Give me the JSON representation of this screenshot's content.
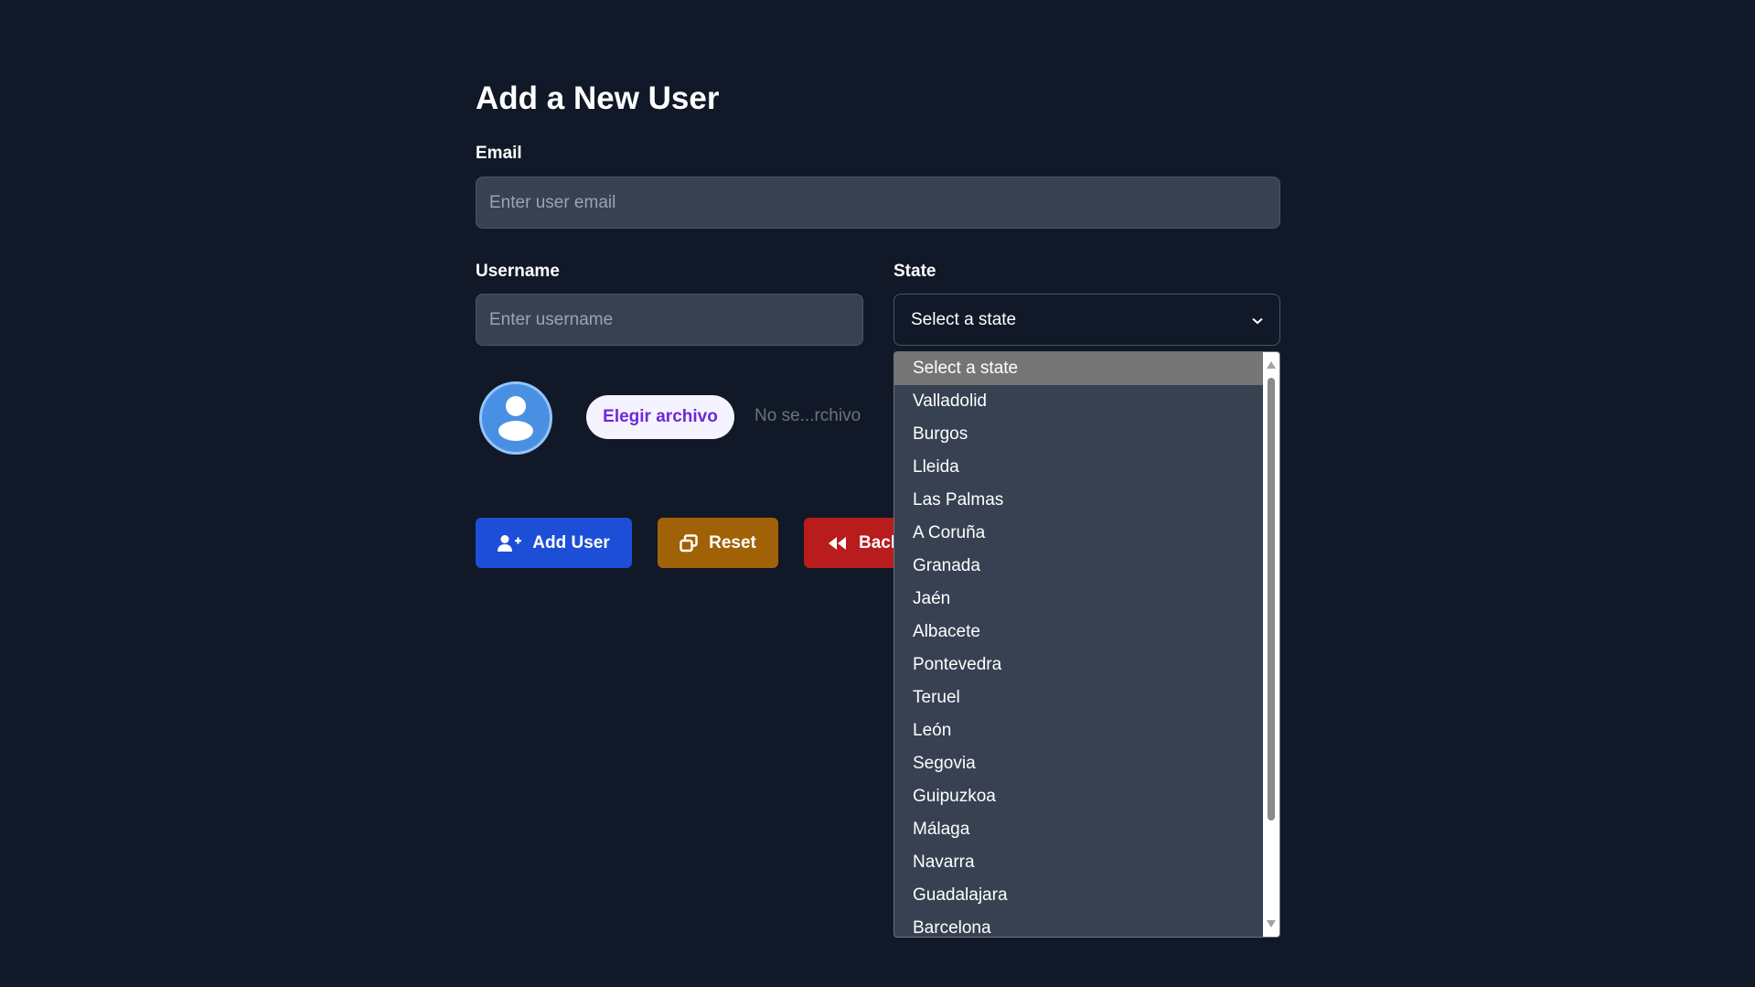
{
  "page": {
    "title": "Add a New User"
  },
  "email": {
    "label": "Email",
    "placeholder": "Enter user email",
    "value": ""
  },
  "username": {
    "label": "Username",
    "placeholder": "Enter username",
    "value": ""
  },
  "state": {
    "label": "State",
    "selected": "Select a state",
    "highlighted_index": 0,
    "options": [
      "Select a state",
      "Valladolid",
      "Burgos",
      "Lleida",
      "Las Palmas",
      "A Coruña",
      "Granada",
      "Jaén",
      "Albacete",
      "Pontevedra",
      "Teruel",
      "León",
      "Segovia",
      "Guipuzkoa",
      "Málaga",
      "Navarra",
      "Guadalajara",
      "Barcelona"
    ]
  },
  "avatar": {
    "icon": "user-avatar-icon"
  },
  "file": {
    "button_label": "Elegir archivo",
    "status": "No se...rchivo"
  },
  "actions": {
    "add_label": "Add User",
    "add_icon": "user-plus-icon",
    "add_color": "#1d4ed8",
    "reset_label": "Reset",
    "reset_icon": "window-restore-icon",
    "reset_color": "#a16207",
    "back_label": "Back",
    "back_icon": "backward-icon",
    "back_color": "#b91c1c"
  },
  "colors": {
    "background": "#111827",
    "input_bg": "#374151"
  }
}
